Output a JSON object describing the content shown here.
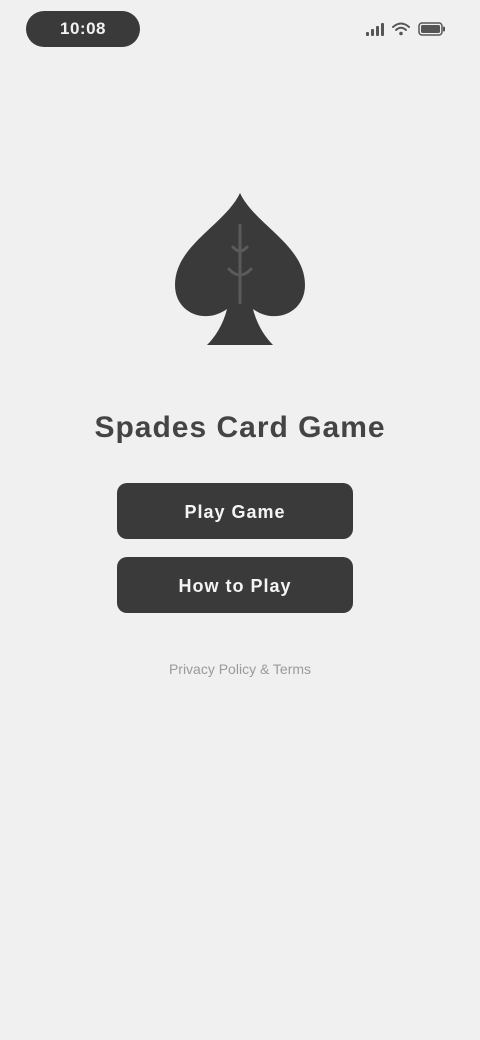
{
  "status_bar": {
    "time": "10:08"
  },
  "app": {
    "title": "Spades Card Game"
  },
  "buttons": {
    "primary_label": "Play Game",
    "secondary_label": "How to Play"
  },
  "footer": {
    "link_text": "Privacy Policy & Terms"
  },
  "icons": {
    "logo": "spade-icon",
    "signal": "signal-icon",
    "wifi": "wifi-icon",
    "battery": "battery-icon"
  },
  "colors": {
    "background": "#f0f0f0",
    "button": "#3a3a3a",
    "button_text": "#f4f4f4",
    "title": "#444444",
    "footer_text": "#9a9a9a"
  }
}
